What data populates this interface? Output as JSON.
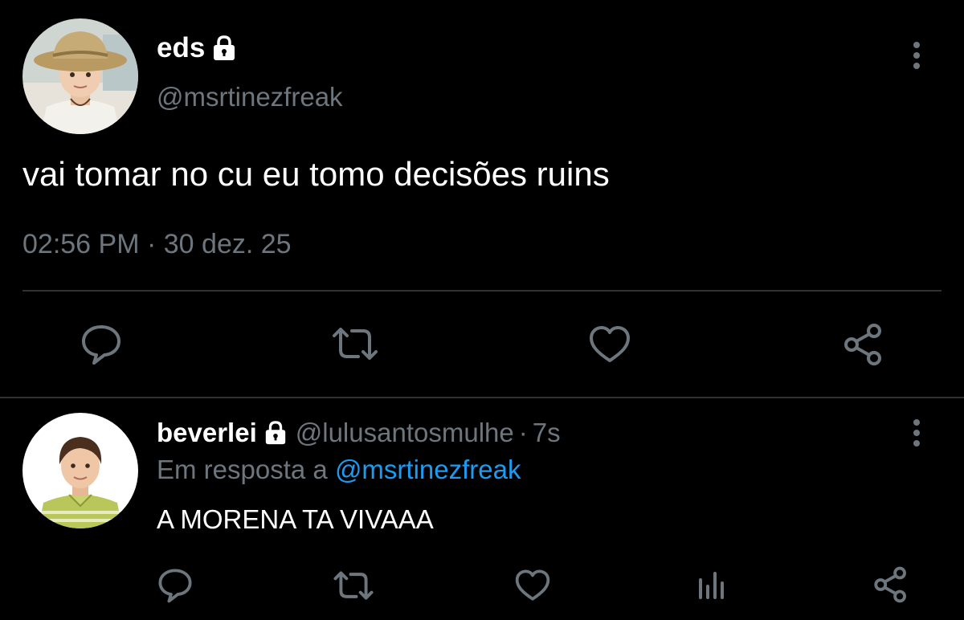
{
  "main_tweet": {
    "name": "eds",
    "handle": "@msrtinezfreak",
    "text": "vai tomar no cu eu tomo decisões ruins",
    "time": "02:56 PM",
    "separator": "·",
    "date": "30 dez. 25",
    "icons": {
      "lock": "lock-icon",
      "more": "more-vertical-icon",
      "reply": "reply-icon",
      "retweet": "retweet-icon",
      "like": "heart-icon",
      "share": "share-icon"
    }
  },
  "reply_tweet": {
    "name": "beverlei",
    "handle": "@lulusantosmulhe",
    "separator": "·",
    "time": "7s",
    "reply_prefix": "Em resposta a",
    "reply_to": "@msrtinezfreak",
    "text": "A MORENA TA VIVAAA",
    "icons": {
      "lock": "lock-icon",
      "more": "more-vertical-icon",
      "reply": "reply-icon",
      "retweet": "retweet-icon",
      "like": "heart-icon",
      "analytics": "analytics-icon",
      "share": "share-icon"
    }
  },
  "colors": {
    "background": "#000000",
    "text_primary": "#ffffff",
    "text_secondary": "#6e767d",
    "link": "#1d9bf0",
    "divider": "#2f3336",
    "icon": "#6e767d"
  }
}
